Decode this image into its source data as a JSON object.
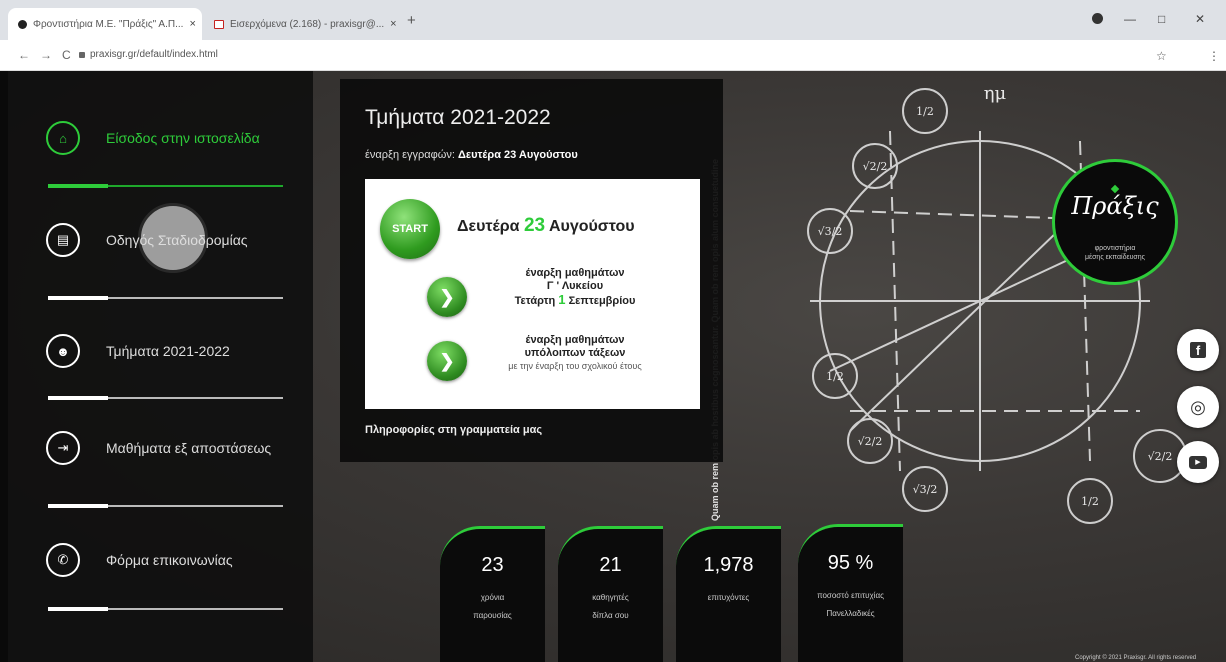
{
  "browser": {
    "tabs": [
      {
        "title": "Φροντιστήρια Μ.Ε. \"Πράξις\" Α.Π...",
        "close": "×"
      },
      {
        "title": "Εισερχόμενα (2.168) - praxisgr@...",
        "close": "×"
      }
    ],
    "new_tab": "+",
    "url": "praxisgr.gr/default/index.html",
    "nav": {
      "back": "←",
      "forward": "→",
      "reload": "C"
    },
    "window": {
      "minimize": "—",
      "maximize": "□",
      "close": "✕"
    },
    "star": "☆",
    "menu": "⋮"
  },
  "sidebar": {
    "items": [
      {
        "label": "Είσοδος στην ιστοσελίδα",
        "icon": "home-icon",
        "glyph": "⌂",
        "active": true
      },
      {
        "label": "Οδηγός Σταδιοδρομίας",
        "icon": "book-icon",
        "glyph": "▤",
        "active": false
      },
      {
        "label": "Τμήματα 2021-2022",
        "icon": "users-icon",
        "glyph": "☻",
        "active": false
      },
      {
        "label": "Μαθήματα εξ αποστάσεως",
        "icon": "sign-in-icon",
        "glyph": "⇥",
        "active": false
      },
      {
        "label": "Φόρμα επικοινωνίας",
        "icon": "phone-icon",
        "glyph": "✆",
        "active": false
      }
    ]
  },
  "panel": {
    "title": "Τμήματα 2021-2022",
    "subtitle_prefix": "έναρξη εγγραφών:",
    "subtitle_date": "Δευτέρα 23 Αυγούστου",
    "card": {
      "start_label": "START",
      "date_prefix": "Δευτέρα",
      "date_num": "23",
      "date_suffix": "Αυγούστου",
      "block1_line1": "έναρξη μαθημάτων",
      "block1_line2": "Γ ' Λυκείου",
      "block1_line3_prefix": "Τετάρτη",
      "block1_line3_num": "1",
      "block1_line3_suffix": "Σεπτεμβρίου",
      "block2_line1": "έναρξη μαθημάτων",
      "block2_line2": "υπόλοιπων τάξεων",
      "block2_line3": "με την έναρξη του σχολικού έτους",
      "arrow_glyph": "❯"
    },
    "info": "Πληροφορίες στη γραμματεία μας"
  },
  "background_text": "Quam ob rem opis ab hostibus cognoscantur. Quam ob rem opis alum consuetudine",
  "logo": {
    "name": "Πράξις",
    "tagline_1": "φροντιστήρια",
    "tagline_2": "μέσης εκπαίδευσης"
  },
  "social": [
    {
      "name": "facebook-icon",
      "glyph": "f"
    },
    {
      "name": "instagram-icon",
      "glyph": "◎"
    },
    {
      "name": "youtube-icon",
      "glyph": "▶"
    }
  ],
  "stats": [
    {
      "value": "23",
      "label_1": "χρόνια",
      "label_2": "παρουσίας"
    },
    {
      "value": "21",
      "label_1": "καθηγητές",
      "label_2": "δίπλα σου"
    },
    {
      "value": "1,978",
      "label_1": "επιτυχόντες",
      "label_2": ""
    },
    {
      "value": "95 %",
      "label_1": "ποσοστό επιτυχίας",
      "label_2": "Πανελλαδικές"
    }
  ],
  "board_labels": {
    "top_formula": "ημ",
    "f1": "1/2",
    "f2": "√2/2",
    "f3": "√3/2"
  },
  "copyright": "Copyright © 2021 Praxisgr. All rights reserved",
  "colors": {
    "accent": "#2ecc3a",
    "panel": "#0c0c0c"
  }
}
